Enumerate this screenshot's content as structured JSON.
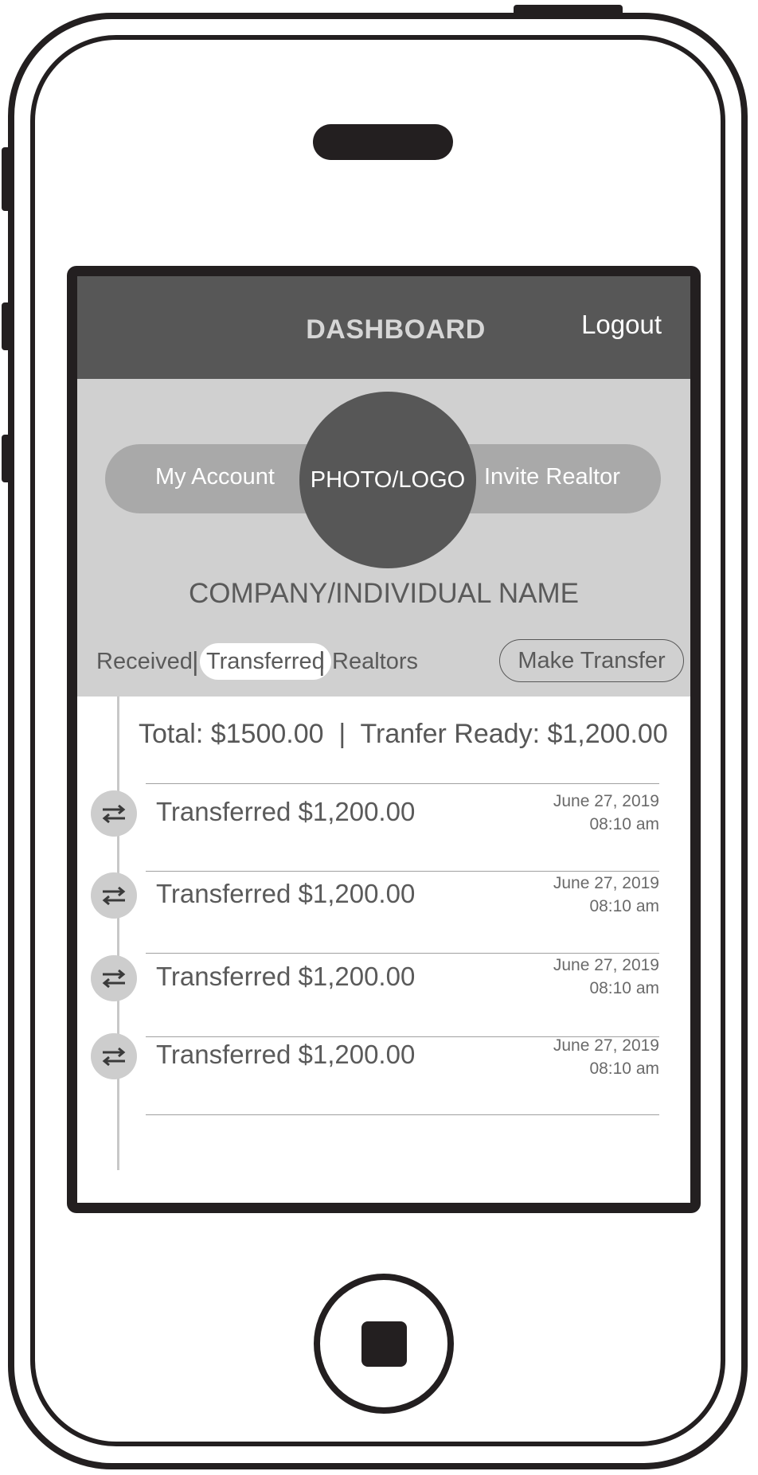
{
  "header": {
    "title": "DASHBOARD",
    "logout_label": "Logout"
  },
  "profile": {
    "my_account_label": "My Account",
    "photo_label": "PHOTO/LOGO",
    "invite_label": "Invite Realtor",
    "company_name": "COMPANY/INDIVIDUAL NAME"
  },
  "tabs": {
    "received": "Received",
    "transferred": "Transferred",
    "realtors": "Realtors",
    "separator": "|",
    "active": "Transferred",
    "make_transfer": "Make Transfer"
  },
  "summary": {
    "text": "Total: $1500.00  |  Tranfer Ready: $1,200.00"
  },
  "transactions": [
    {
      "label": "Transferred $1,200.00",
      "date": "June 27, 2019",
      "time": "08:10 am",
      "icon": "transfer-arrows-icon"
    },
    {
      "label": "Transferred $1,200.00",
      "date": "June 27, 2019",
      "time": "08:10 am",
      "icon": "transfer-arrows-icon"
    },
    {
      "label": "Transferred $1,200.00",
      "date": "June 27, 2019",
      "time": "08:10 am",
      "icon": "transfer-arrows-icon"
    },
    {
      "label": "Transferred $1,200.00",
      "date": "June 27, 2019",
      "time": "08:10 am",
      "icon": "transfer-arrows-icon"
    }
  ],
  "colors": {
    "header_bg": "#575757",
    "profile_bg": "#d0d0d0",
    "pill_bg": "#a9a9a9",
    "avatar_bg": "#575757",
    "text": "#5a5a5a"
  }
}
